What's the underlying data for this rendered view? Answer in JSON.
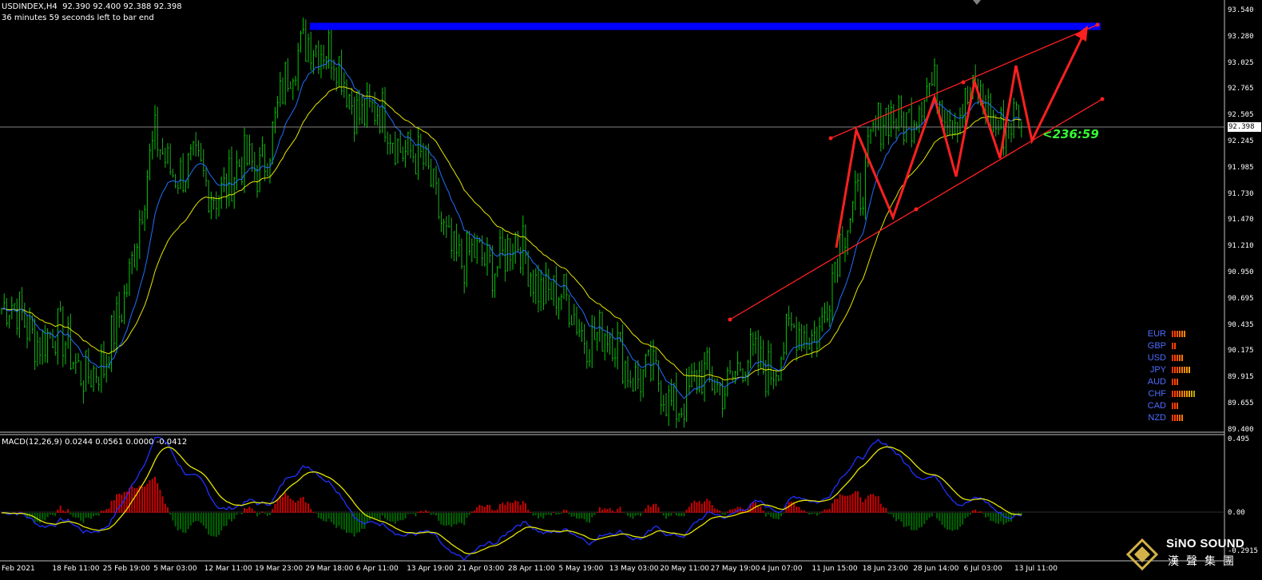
{
  "header": {
    "line1": "USDINDEX,H4  92.390 92.400 92.388 92.398",
    "line2": "36 minutes 59 seconds left to bar end"
  },
  "macd_header": "MACD(12,26,9) 0.0244 0.0561 0.0000 -0.0412",
  "price_tag": "92.398",
  "countdown": "<236:59",
  "price_axis": [
    "93.540",
    "93.280",
    "93.025",
    "92.765",
    "92.505",
    "92.245",
    "91.985",
    "91.730",
    "91.470",
    "91.210",
    "90.950",
    "90.695",
    "90.435",
    "90.175",
    "89.915",
    "89.655",
    "89.400"
  ],
  "macd_axis": [
    "0.495",
    "0.00",
    "-0.2915"
  ],
  "time_axis": [
    "Feb 2021",
    "18 Feb 11:00",
    "25 Feb 19:00",
    "5 Mar 03:00",
    "12 Mar 11:00",
    "19 Mar 23:00",
    "29 Mar 18:00",
    "6 Apr 11:00",
    "13 Apr 19:00",
    "21 Apr 03:00",
    "28 Apr 11:00",
    "5 May 19:00",
    "13 May 03:00",
    "20 May 11:00",
    "27 May 19:00",
    "4 Jun 07:00",
    "11 Jun 15:00",
    "18 Jun 23:00",
    "28 Jun 14:00",
    "6 Jul 03:00",
    "13 Jul 11:00"
  ],
  "strength_panel": [
    {
      "name": "EUR",
      "level": 6
    },
    {
      "name": "GBP",
      "level": 2
    },
    {
      "name": "USD",
      "level": 5
    },
    {
      "name": "JPY",
      "level": 8
    },
    {
      "name": "AUD",
      "level": 3
    },
    {
      "name": "CHF",
      "level": 10
    },
    {
      "name": "CAD",
      "level": 3
    },
    {
      "name": "NZD",
      "level": 5
    }
  ],
  "logo": {
    "name": "SiNO SOUND",
    "sub": "漢聲集團"
  },
  "colors": {
    "bull": "#00cc00",
    "bear": "#22aa22",
    "ma_fast": "#1f6fff",
    "ma_slow": "#e5e500",
    "resistance": "#0000ff",
    "trend": "#ff2020",
    "macd_pos": "#cc0000",
    "macd_neg": "#006600",
    "macd_signal": "#e5e500",
    "macd_main": "#2030ff"
  },
  "chart_data": {
    "type": "line",
    "symbol": "USDINDEX",
    "timeframe": "H4",
    "last_price": 92.398,
    "ylim": [
      89.4,
      93.54
    ],
    "key_points": [
      {
        "x": "11 Feb 2021",
        "y": 90.6
      },
      {
        "x": "18 Feb 11:00",
        "y": 90.3
      },
      {
        "x": "25 Feb 19:00",
        "y": 89.9
      },
      {
        "x": "5 Mar 03:00",
        "y": 92.2
      },
      {
        "x": "12 Mar 11:00",
        "y": 91.8
      },
      {
        "x": "19 Mar 23:00",
        "y": 92.0
      },
      {
        "x": "29 Mar 18:00",
        "y": 93.4
      },
      {
        "x": "6 Apr 11:00",
        "y": 92.6
      },
      {
        "x": "13 Apr 19:00",
        "y": 92.2
      },
      {
        "x": "21 Apr 03:00",
        "y": 91.0
      },
      {
        "x": "28 Apr 11:00",
        "y": 91.2
      },
      {
        "x": "5 May 19:00",
        "y": 90.6
      },
      {
        "x": "13 May 03:00",
        "y": 90.2
      },
      {
        "x": "20 May 11:00",
        "y": 89.7
      },
      {
        "x": "27 May 19:00",
        "y": 89.9
      },
      {
        "x": "4 Jun 07:00",
        "y": 90.1
      },
      {
        "x": "11 Jun 15:00",
        "y": 90.5
      },
      {
        "x": "18 Jun 23:00",
        "y": 92.3
      },
      {
        "x": "28 Jun 14:00",
        "y": 92.7
      },
      {
        "x": "6 Jul 03:00",
        "y": 92.6
      },
      {
        "x": "13 Jul 11:00",
        "y": 92.4
      }
    ],
    "resistance_level": 93.44,
    "macd": {
      "params": "12,26,9",
      "values": [
        0.0244,
        0.0561,
        0.0,
        -0.0412
      ],
      "ylim": [
        -0.2915,
        0.495
      ]
    }
  }
}
